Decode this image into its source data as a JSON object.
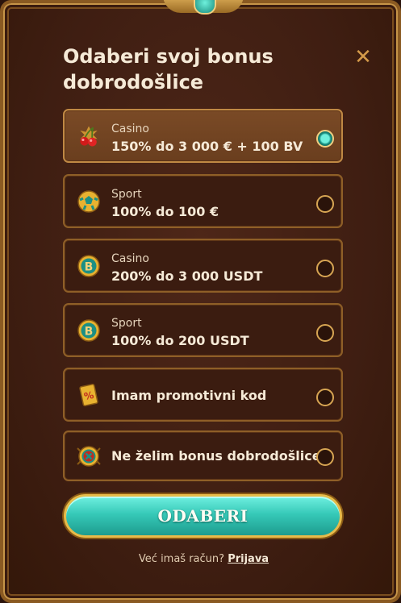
{
  "dialog": {
    "title": "Odaberi svoj bonus\ndobrodošlice",
    "close_label": "✕"
  },
  "options": [
    {
      "category": "Casino",
      "label": "150% do 3 000 € + 100 BV",
      "icon": "cherries-icon",
      "selected": true
    },
    {
      "category": "Sport",
      "label": "100% do 100 €",
      "icon": "sport-ball-icon",
      "selected": false
    },
    {
      "category": "Casino",
      "label": "200% do 3 000 USDT",
      "icon": "bitcoin-icon",
      "selected": false
    },
    {
      "category": "Sport",
      "label": "100% do 200 USDT",
      "icon": "bitcoin-icon",
      "selected": false
    },
    {
      "category": "",
      "label": "Imam promotivni kod",
      "icon": "promo-code-icon",
      "selected": false
    },
    {
      "category": "",
      "label": "Ne želim bonus dobrodošlice",
      "icon": "no-bonus-icon",
      "selected": false
    }
  ],
  "submit_label": "ODABERI",
  "footer": {
    "question": "Već imaš račun?",
    "login_link": "Prijava"
  },
  "colors": {
    "accent": "#36c9b8",
    "border_gold": "#c69548",
    "panel": "#3f1e12"
  }
}
